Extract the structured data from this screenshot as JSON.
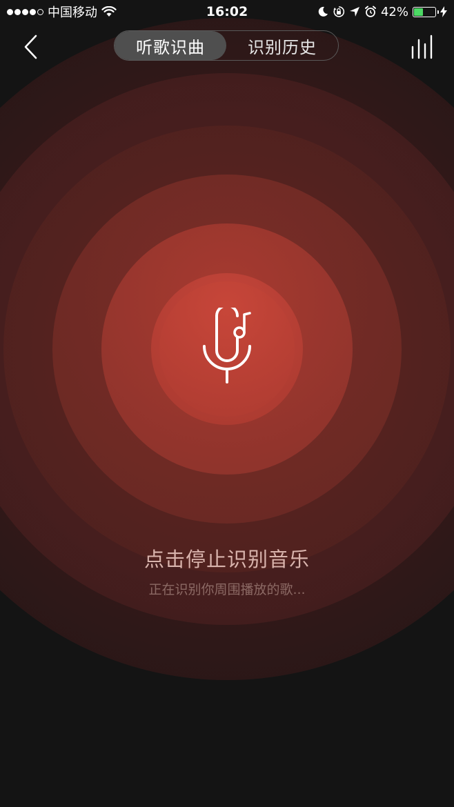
{
  "status_bar": {
    "carrier": "中国移动",
    "time": "16:02",
    "battery_percent": "42%",
    "battery_level": 0.42,
    "signal_dots_filled": 4,
    "signal_dots_total": 5
  },
  "header": {
    "tabs": [
      {
        "label": "听歌识曲",
        "active": true
      },
      {
        "label": "识别历史",
        "active": false
      }
    ]
  },
  "main": {
    "hint": "点击停止识别音乐",
    "status": "正在识别你周围播放的歌..."
  },
  "colors": {
    "background": "#141414",
    "accent": "#c4453a",
    "battery_fill": "#4cd964"
  },
  "icons": {
    "back": "chevron-left-icon",
    "equalizer": "equalizer-bars-icon",
    "mic": "microphone-music-note-icon",
    "wifi": "wifi-icon",
    "moon": "moon-icon",
    "rotation_lock": "rotation-lock-icon",
    "location": "location-arrow-icon",
    "alarm": "alarm-clock-icon",
    "charging": "charging-bolt-icon"
  }
}
